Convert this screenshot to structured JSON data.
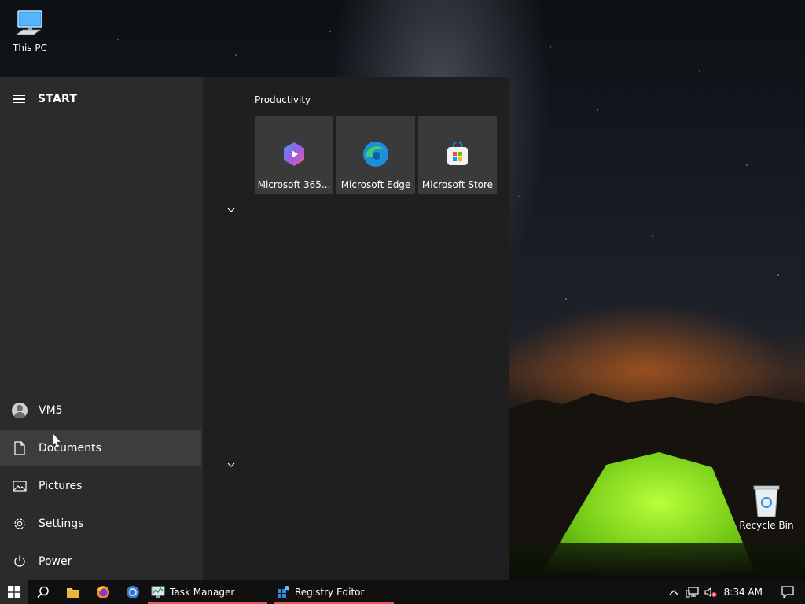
{
  "desktop": {
    "icons": [
      {
        "label": "This PC",
        "icon": "computer-icon"
      },
      {
        "label": "Recycle Bin",
        "icon": "recycle-bin-icon"
      }
    ]
  },
  "start_menu": {
    "title": "START",
    "group": {
      "title": "Productivity",
      "tiles": [
        {
          "label": "Microsoft 365...",
          "icon": "microsoft-365-icon"
        },
        {
          "label": "Microsoft Edge",
          "icon": "edge-icon"
        },
        {
          "label": "Microsoft Store",
          "icon": "store-icon"
        }
      ]
    },
    "left_items": [
      {
        "label": "VM5",
        "icon": "user-avatar-icon"
      },
      {
        "label": "Documents",
        "icon": "document-icon",
        "hovered": true
      },
      {
        "label": "Pictures",
        "icon": "pictures-icon"
      },
      {
        "label": "Settings",
        "icon": "gear-icon"
      },
      {
        "label": "Power",
        "icon": "power-icon"
      }
    ]
  },
  "taskbar": {
    "apps": [
      {
        "label": "Task Manager",
        "icon": "task-manager-icon"
      },
      {
        "label": "Registry Editor",
        "icon": "registry-editor-icon"
      }
    ],
    "clock": "8:34 AM"
  },
  "colors": {
    "menu_left": "#2b2b2b",
    "menu_right": "#1f1f1f",
    "tile": "#3a3a3a",
    "taskbar": "#101010",
    "running_indicator": "#e35a5a"
  }
}
